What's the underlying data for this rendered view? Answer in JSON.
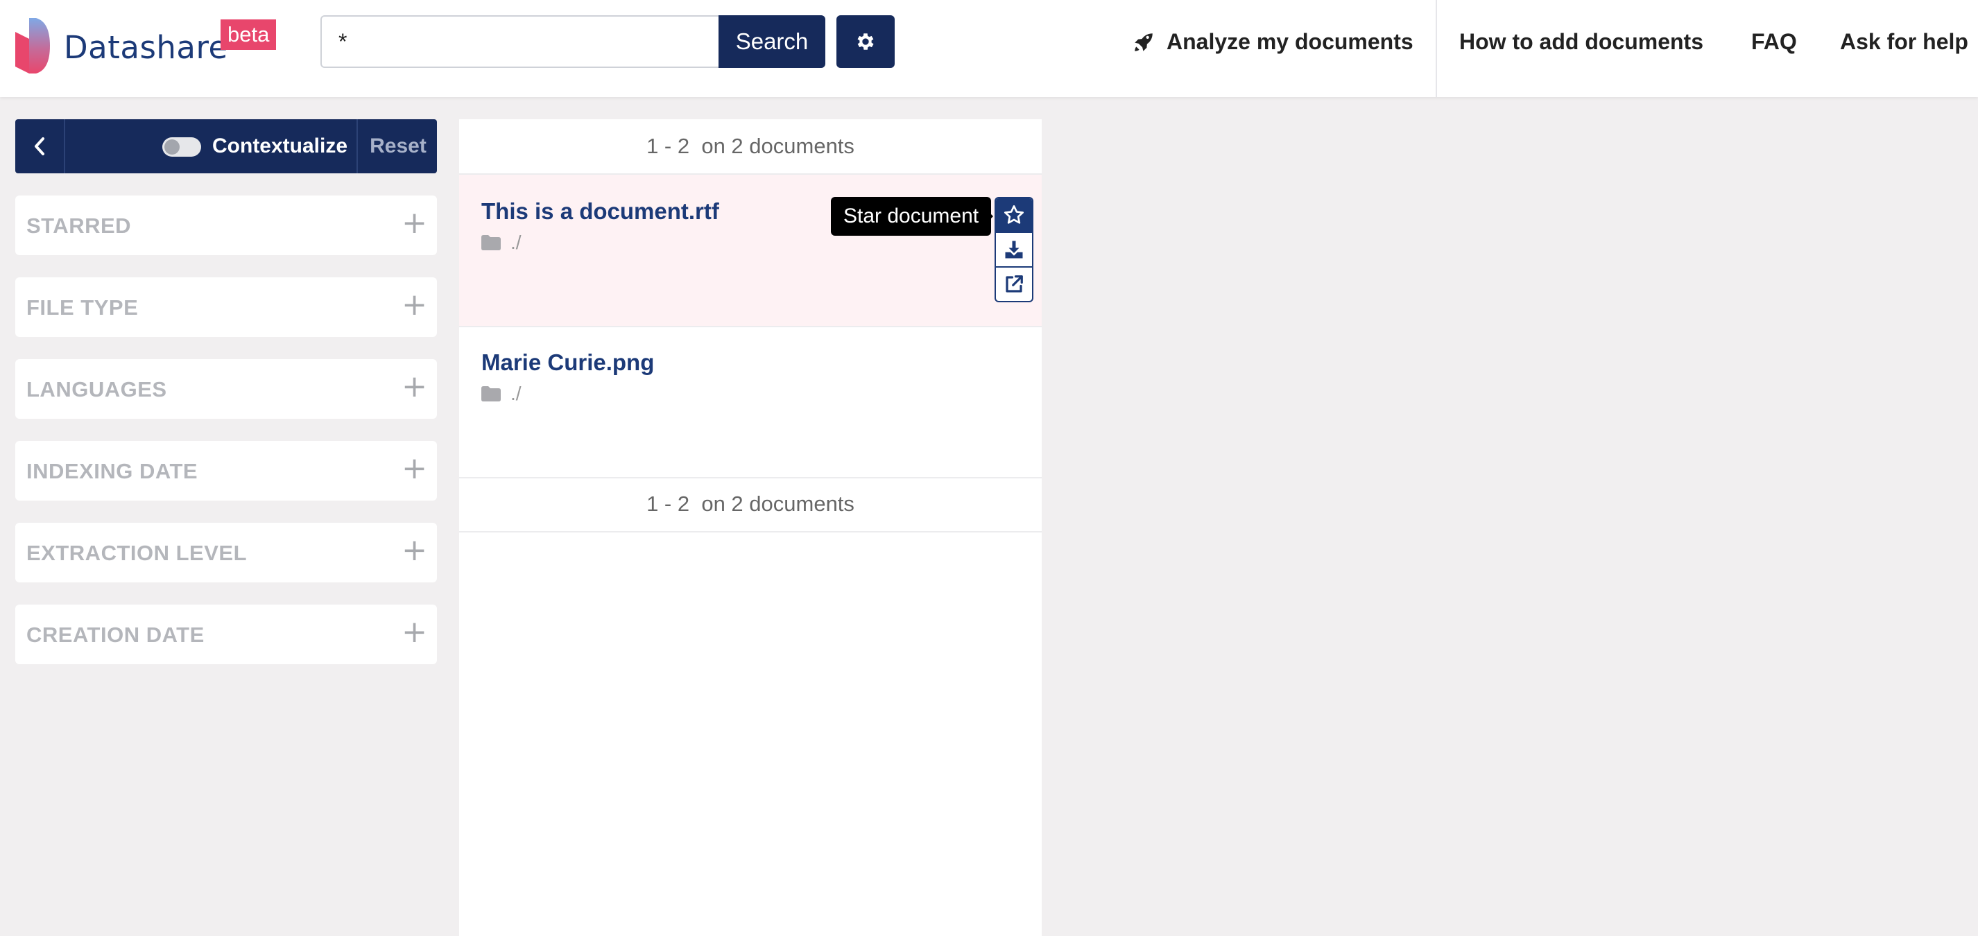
{
  "header": {
    "logo_text": "Datashare",
    "beta_label": "beta",
    "search_value": "*",
    "search_button": "Search",
    "settings_icon": "gear-icon",
    "nav": {
      "analyze": "Analyze my documents",
      "how_to": "How to add documents",
      "faq": "FAQ",
      "help": "Ask for help"
    }
  },
  "sidebar": {
    "contextualize_label": "Contextualize",
    "contextualize_on": false,
    "reset_label": "Reset",
    "filters": [
      {
        "label": "STARRED"
      },
      {
        "label": "FILE TYPE"
      },
      {
        "label": "LANGUAGES"
      },
      {
        "label": "INDEXING DATE"
      },
      {
        "label": "EXTRACTION LEVEL"
      },
      {
        "label": "CREATION DATE"
      }
    ]
  },
  "results": {
    "pagination_top": "1 - 2  on 2 documents",
    "pagination_bottom": "1 - 2  on 2 documents",
    "documents": [
      {
        "title": "This is a document.rtf",
        "path": "./"
      },
      {
        "title": "Marie Curie.png",
        "path": "./"
      }
    ],
    "tooltip": "Star document"
  },
  "colors": {
    "brand_navy": "#162a5b",
    "link_blue": "#1c3a78",
    "beta_pink": "#e8466c",
    "active_row": "#fef2f4",
    "page_bg": "#f1eff0"
  }
}
